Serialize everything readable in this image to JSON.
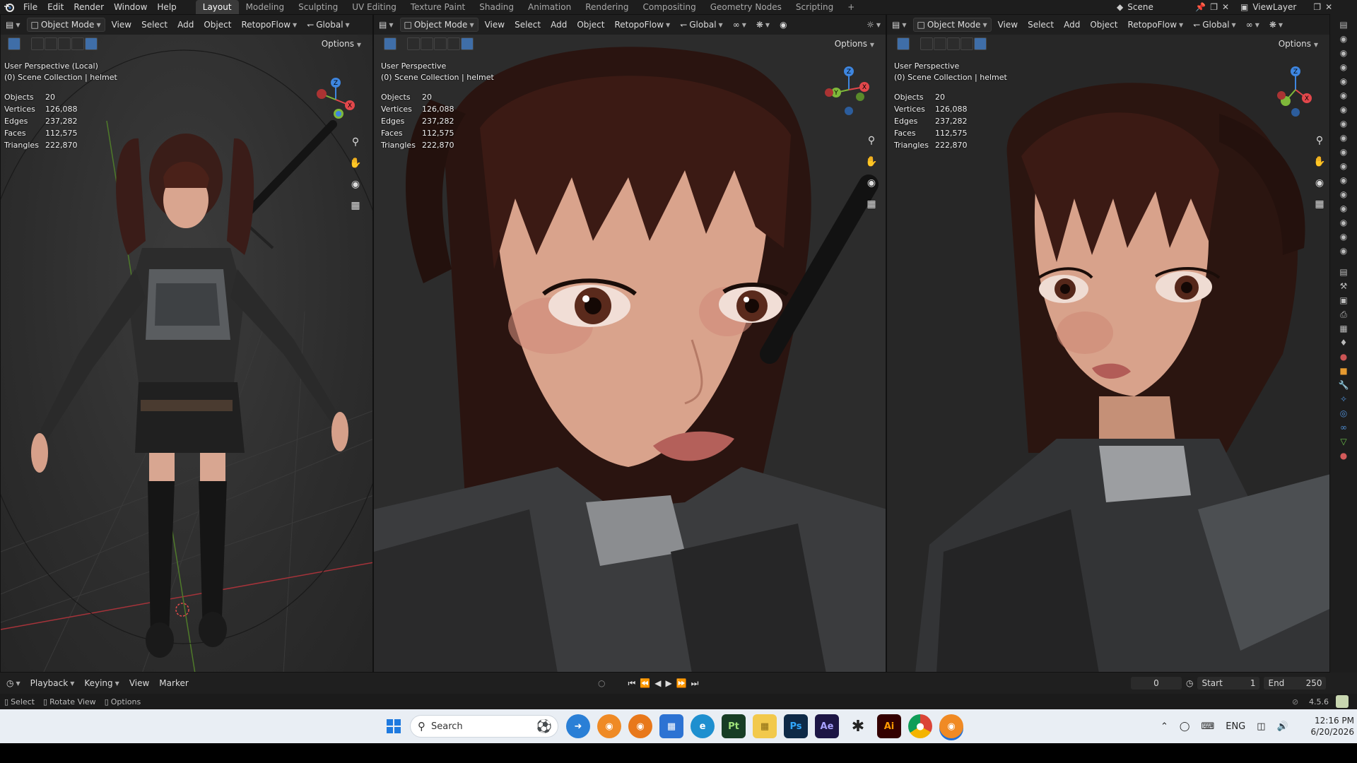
{
  "topbar": {
    "menus": [
      "File",
      "Edit",
      "Render",
      "Window",
      "Help"
    ],
    "workspaces": [
      "Layout",
      "Modeling",
      "Sculpting",
      "UV Editing",
      "Texture Paint",
      "Shading",
      "Animation",
      "Rendering",
      "Compositing",
      "Geometry Nodes",
      "Scripting"
    ],
    "active_workspace": "Layout",
    "add_tab": "+",
    "scene": "Scene",
    "view_layer": "ViewLayer"
  },
  "viewports": [
    {
      "mode": "Object Mode",
      "menus": [
        "View",
        "Select",
        "Add",
        "Object"
      ],
      "addon": "RetopoFlow",
      "orientation": "Global",
      "options": "Options",
      "perspective": "User Perspective (Local)",
      "collection": "(0) Scene Collection | helmet"
    },
    {
      "mode": "Object Mode",
      "menus": [
        "View",
        "Select",
        "Add",
        "Object"
      ],
      "addon": "RetopoFlow",
      "orientation": "Global",
      "options": "Options",
      "perspective": "User Perspective",
      "collection": "(0) Scene Collection | helmet"
    },
    {
      "mode": "Object Mode",
      "menus": [
        "View",
        "Select",
        "Add",
        "Object"
      ],
      "addon": "RetopoFlow",
      "orientation": "Global",
      "options": "Options",
      "perspective": "User Perspective",
      "collection": "(0) Scene Collection | helmet"
    }
  ],
  "stats": {
    "labels": [
      "Objects",
      "Vertices",
      "Edges",
      "Faces",
      "Triangles"
    ],
    "values": [
      "20",
      "126,088",
      "237,282",
      "112,575",
      "222,870"
    ]
  },
  "timeline": {
    "menus": [
      "Playback",
      "Keying",
      "View",
      "Marker"
    ],
    "current_frame": "0",
    "start_label": "Start",
    "start": "1",
    "end_label": "End",
    "end": "250"
  },
  "statusbar": {
    "select": "Select",
    "rotate": "Rotate View",
    "options": "Options",
    "version": "4.5.6"
  },
  "taskbar": {
    "search_placeholder": "Search",
    "lang": "ENG",
    "time": "12:16 PM",
    "date": "6/20/2026",
    "apps": [
      "Pt",
      "Ps",
      "Ae",
      "Ai"
    ]
  },
  "colors": {
    "accent": "#3f6ea8",
    "x_axis": "#e2474b",
    "y_axis": "#7fb83a",
    "z_axis": "#3e86e0"
  }
}
